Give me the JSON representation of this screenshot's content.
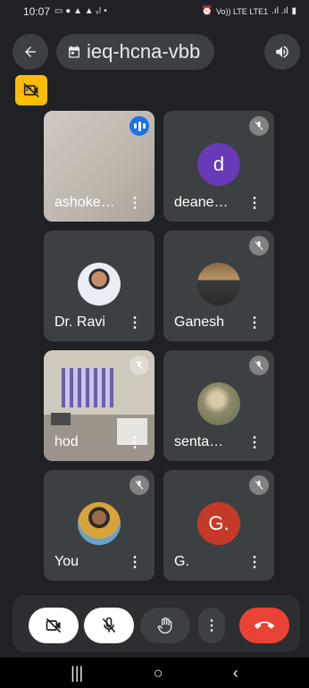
{
  "status_bar": {
    "time": "10:07",
    "network_label": "Vo)) LTE LTE1"
  },
  "top_bar": {
    "back_icon": "arrow-left-icon",
    "meeting_code": "ieq-hcna-vbb",
    "audio_icon": "speaker-icon"
  },
  "indicator": {
    "icon": "camera-off-indicator-icon",
    "color": "#fbbc04"
  },
  "participants": [
    {
      "name": "ashoke…",
      "type": "video",
      "speaking": true
    },
    {
      "name": "deane…",
      "type": "initial",
      "initial": "d",
      "avatar_color": "#673ab7",
      "muted": true
    },
    {
      "name": "Dr. Ravi",
      "type": "photo",
      "muted": true
    },
    {
      "name": "Ganesh",
      "type": "photo",
      "muted": true
    },
    {
      "name": "hod",
      "type": "video",
      "muted": true
    },
    {
      "name": "senta…",
      "type": "photo",
      "muted": true
    },
    {
      "name": "You",
      "type": "photo",
      "muted": true
    },
    {
      "name": "G.",
      "type": "initial",
      "initial": "G.",
      "avatar_color": "#c53929",
      "muted": true
    }
  ],
  "controls": {
    "camera": "camera-off-icon",
    "mic": "mic-off-icon",
    "raise_hand": "hand-icon",
    "more": "more-vert-icon",
    "end_call": "phone-hangup-icon"
  },
  "colors": {
    "background": "#202124",
    "tile": "#3c4043",
    "accent": "#8ab4f8",
    "end_call": "#ea4335"
  }
}
